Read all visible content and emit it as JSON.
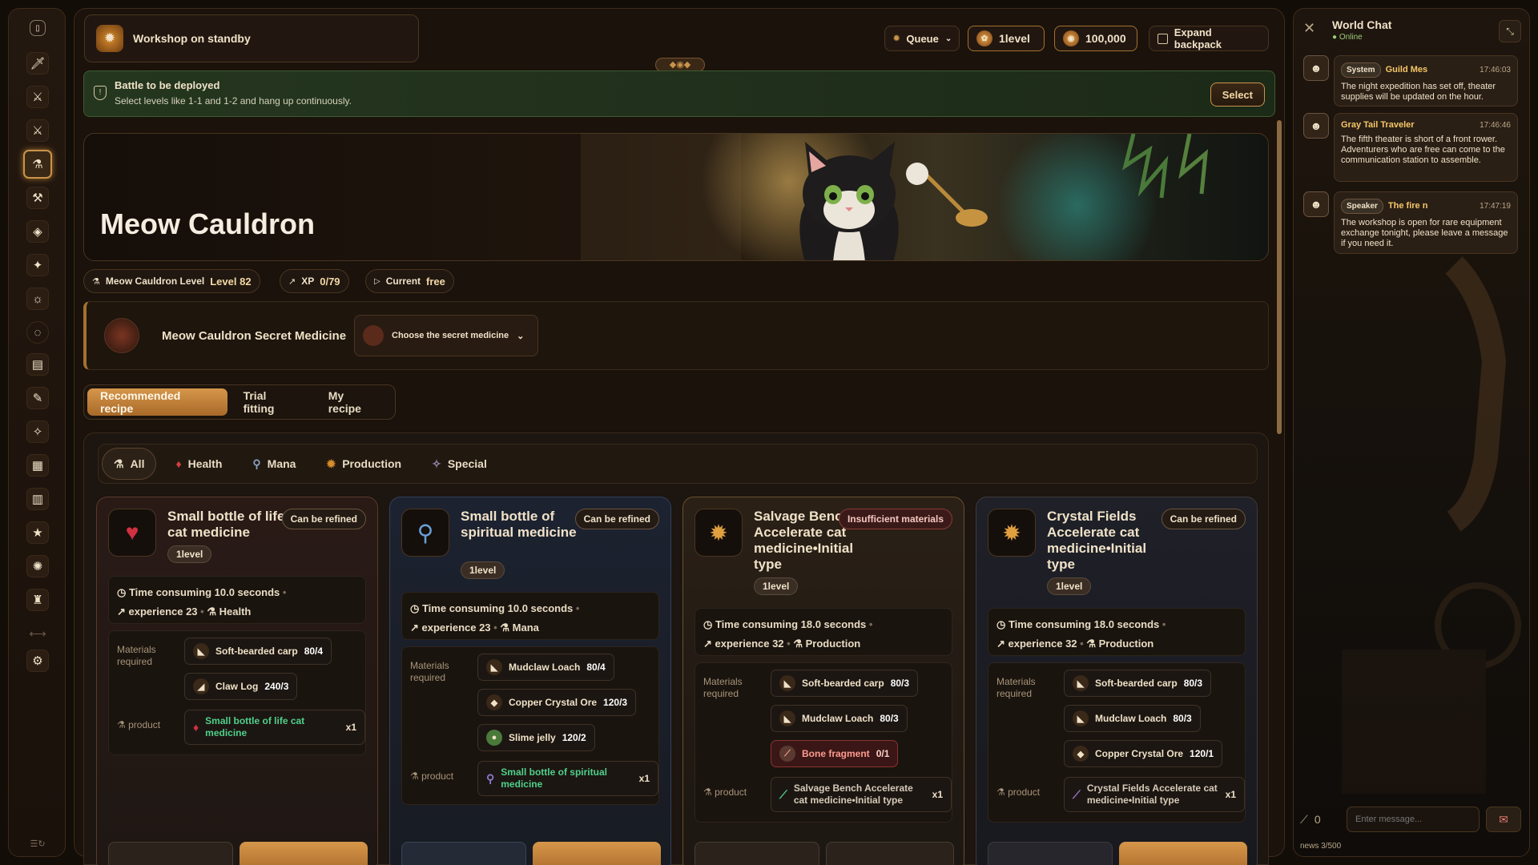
{
  "workshop": {
    "status": "Workshop on standby"
  },
  "topbar": {
    "queue": "Queue",
    "level": "1level",
    "coins": "100,000",
    "expand": "Expand backpack"
  },
  "battle": {
    "title": "Battle to be deployed",
    "subtitle": "Select levels like 1-1 and 1-2 and hang up continuously.",
    "select": "Select"
  },
  "banner": {
    "title": "Meow Cauldron"
  },
  "stats": {
    "level_label": "Meow Cauldron Level",
    "level_value": "Level 82",
    "xp_label": "XP",
    "xp_value": "0/79",
    "current_label": "Current",
    "current_value": "free"
  },
  "secret": {
    "title": "Meow Cauldron Secret Medicine",
    "dropdown": "Choose the secret medicine"
  },
  "tabs": [
    "Recommended recipe",
    "Trial fitting",
    "My recipe"
  ],
  "filters": [
    "All",
    "Health",
    "Mana",
    "Production",
    "Special"
  ],
  "labels": {
    "materials": "Materials required",
    "product": "product",
    "time_prefix": "Time consuming",
    "exp_prefix": "experience"
  },
  "cards": [
    {
      "title": "Small bottle of life cat medicine",
      "badge": "Can be refined",
      "level": "1level",
      "time": "Time consuming 10.0 seconds",
      "exp": "experience 23",
      "type": "Health",
      "materials": [
        {
          "name": "Soft-bearded carp",
          "qty": "80/4"
        },
        {
          "name": "Claw Log",
          "qty": "240/3"
        }
      ],
      "product": "Small bottle of life cat medicine",
      "product_qty": "x1"
    },
    {
      "title": "Small bottle of spiritual medicine",
      "badge": "Can be refined",
      "level": "1level",
      "time": "Time consuming 10.0 seconds",
      "exp": "experience 23",
      "type": "Mana",
      "materials": [
        {
          "name": "Mudclaw Loach",
          "qty": "80/4"
        },
        {
          "name": "Copper Crystal Ore",
          "qty": "120/3"
        },
        {
          "name": "Slime jelly",
          "qty": "120/2"
        }
      ],
      "product": "Small bottle of spiritual medicine",
      "product_qty": "x1"
    },
    {
      "title": "Salvage Bench Accelerate cat medicine•Initial type",
      "badge": "Insufficient materials",
      "level": "1level",
      "time": "Time consuming 18.0 seconds",
      "exp": "experience 32",
      "type": "Production",
      "materials": [
        {
          "name": "Soft-bearded carp",
          "qty": "80/3"
        },
        {
          "name": "Mudclaw Loach",
          "qty": "80/3"
        },
        {
          "name": "Bone fragment",
          "qty": "0/1"
        }
      ],
      "product": "Salvage Bench Accelerate cat medicine•Initial type",
      "product_qty": "x1"
    },
    {
      "title": "Crystal Fields Accelerate cat medicine•Initial type",
      "badge": "Can be refined",
      "level": "1level",
      "time": "Time consuming 18.0 seconds",
      "exp": "experience 32",
      "type": "Production",
      "materials": [
        {
          "name": "Soft-bearded carp",
          "qty": "80/3"
        },
        {
          "name": "Mudclaw Loach",
          "qty": "80/3"
        },
        {
          "name": "Copper Crystal Ore",
          "qty": "120/1"
        }
      ],
      "product": "Crystal Fields Accelerate cat medicine•Initial type",
      "product_qty": "x1"
    }
  ],
  "chat": {
    "title": "World Chat",
    "status": "Online",
    "messages": [
      {
        "tag": "System",
        "name": "Guild Mes",
        "time": "17:46:03",
        "text": "The night expedition has set off, theater supplies will be updated on the hour."
      },
      {
        "tag": "",
        "name": "Gray Tail Traveler",
        "time": "17:46:46",
        "text": "The fifth theater is short of a front rower. Adventurers who are free can come to the communication station to assemble."
      },
      {
        "tag": "Speaker",
        "name": "The fire n",
        "time": "17:47:19",
        "text": "The workshop is open for rare equipment exchange tonight, please leave a message if you need it."
      }
    ],
    "speaker_count": "0",
    "input_placeholder": "Enter message...",
    "counter": "news 3/500"
  },
  "colors": {
    "accent": "#c9944a",
    "success": "#4fd08a",
    "danger": "#ff9b90",
    "name": "#f6c768"
  }
}
